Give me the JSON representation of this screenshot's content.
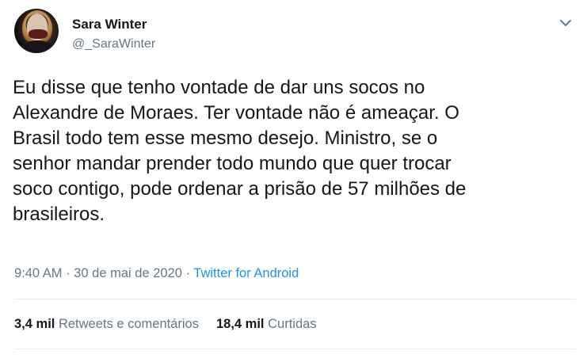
{
  "author": {
    "name": "Sara Winter",
    "handle": "@_SaraWinter"
  },
  "tweet": {
    "lines": [
      "Eu disse que tenho vontade de dar uns socos no",
      "Alexandre de Moraes. Ter vontade não é ameaçar. O",
      "Brasil todo tem esse mesmo desejo. Ministro, se o",
      "senhor mandar prender todo mundo que quer trocar",
      "soco contigo, pode ordenar a prisão de 57 milhões de",
      "brasileiros."
    ],
    "time": "9:40 AM",
    "separator1": " · ",
    "date": "30 de mai de 2020",
    "separator2": " · ",
    "source": "Twitter for Android"
  },
  "stats": {
    "retweets_count": "3,4 mil",
    "retweets_label": "Retweets e comentários",
    "likes_count": "18,4 mil",
    "likes_label": "Curtidas"
  },
  "icons": {
    "menu": "chevron-down-icon",
    "avatar": "profile-photo"
  },
  "colors": {
    "text": "#14171a",
    "secondary": "#657786",
    "link": "#1b95e0",
    "divider": "#e6ecf0"
  }
}
